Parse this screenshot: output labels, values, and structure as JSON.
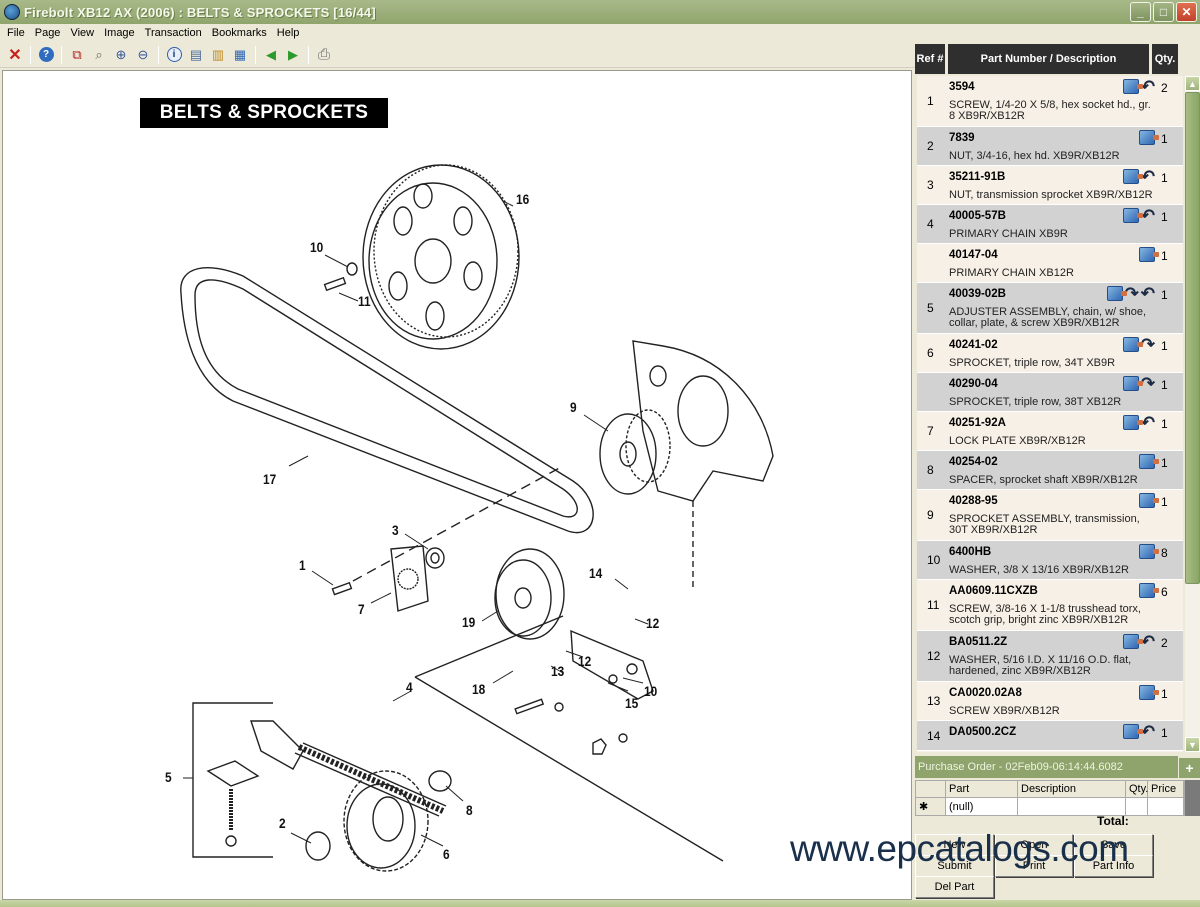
{
  "window": {
    "title": "Firebolt XB12 AX (2006) : BELTS & SPROCKETS [16/44]",
    "controls": [
      "minimize",
      "maximize",
      "close"
    ]
  },
  "menu": [
    "File",
    "Page",
    "View",
    "Image",
    "Transaction",
    "Bookmarks",
    "Help"
  ],
  "toolbar": [
    {
      "icon": "close-icon",
      "glyph": "✕"
    },
    {
      "icon": "help-icon",
      "glyph": "?"
    },
    {
      "icon": "fit-window-icon",
      "glyph": "⧉"
    },
    {
      "icon": "zoom-icon",
      "glyph": "⌕"
    },
    {
      "icon": "zoom-in-icon",
      "glyph": "⊕"
    },
    {
      "icon": "zoom-out-icon",
      "glyph": "⊖"
    },
    {
      "icon": "info-icon",
      "glyph": "i"
    },
    {
      "icon": "document-icon",
      "glyph": "▤"
    },
    {
      "icon": "bookmark-icon",
      "glyph": "▥"
    },
    {
      "icon": "add-to-order-icon",
      "glyph": "▦"
    },
    {
      "icon": "previous-page-icon",
      "glyph": "◀"
    },
    {
      "icon": "next-page-icon",
      "glyph": "▶"
    },
    {
      "icon": "print-icon",
      "glyph": "⎙"
    }
  ],
  "diagram": {
    "title": "BELTS & SPROCKETS",
    "callouts": [
      "1",
      "2",
      "3",
      "4",
      "5",
      "6",
      "7",
      "8",
      "9",
      "10",
      "10",
      "11",
      "12",
      "12",
      "13",
      "14",
      "15",
      "16",
      "17",
      "18",
      "19"
    ]
  },
  "parts_header": {
    "ref": "Ref #",
    "part": "Part Number / Description",
    "qty": "Qty."
  },
  "parts": [
    {
      "ref": "1",
      "part": "3594",
      "desc": "SCREW, 1/4-20 X 5/8, hex socket hd., gr. 8 XB9R/XB12R",
      "qty": "2",
      "icons": [
        "add-to-order",
        "back-arrow"
      ]
    },
    {
      "ref": "2",
      "part": "7839",
      "desc": "NUT, 3/4-16, hex hd. XB9R/XB12R",
      "qty": "1",
      "icons": [
        "add-to-order"
      ]
    },
    {
      "ref": "3",
      "part": "35211-91B",
      "desc": "NUT, transmission sprocket XB9R/XB12R",
      "qty": "1",
      "icons": [
        "add-to-order",
        "back-arrow"
      ]
    },
    {
      "ref": "4",
      "part": "40005-57B",
      "desc": "PRIMARY CHAIN XB9R",
      "qty": "1",
      "icons": [
        "add-to-order",
        "back-arrow"
      ]
    },
    {
      "ref": "",
      "part": "40147-04",
      "desc": "PRIMARY CHAIN XB12R",
      "qty": "1",
      "icons": [
        "add-to-order"
      ]
    },
    {
      "ref": "5",
      "part": "40039-02B",
      "desc": "ADJUSTER ASSEMBLY, chain, w/ shoe, collar, plate, & screw XB9R/XB12R",
      "qty": "1",
      "icons": [
        "add-to-order",
        "forward-arrow",
        "back-arrow"
      ]
    },
    {
      "ref": "6",
      "part": "40241-02",
      "desc": "SPROCKET, triple row, 34T XB9R",
      "qty": "1",
      "icons": [
        "add-to-order",
        "forward-arrow"
      ]
    },
    {
      "ref": "",
      "part": "40290-04",
      "desc": "SPROCKET, triple row, 38T XB12R",
      "qty": "1",
      "icons": [
        "add-to-order",
        "forward-arrow"
      ]
    },
    {
      "ref": "7",
      "part": "40251-92A",
      "desc": "LOCK PLATE XB9R/XB12R",
      "qty": "1",
      "icons": [
        "add-to-order",
        "back-arrow"
      ]
    },
    {
      "ref": "8",
      "part": "40254-02",
      "desc": "SPACER, sprocket shaft XB9R/XB12R",
      "qty": "1",
      "icons": [
        "add-to-order"
      ]
    },
    {
      "ref": "9",
      "part": "40288-95",
      "desc": "SPROCKET ASSEMBLY, transmission, 30T XB9R/XB12R",
      "qty": "1",
      "icons": [
        "add-to-order"
      ]
    },
    {
      "ref": "10",
      "part": "6400HB",
      "desc": "WASHER, 3/8 X 13/16 XB9R/XB12R",
      "qty": "8",
      "icons": [
        "add-to-order"
      ]
    },
    {
      "ref": "11",
      "part": "AA0609.11CXZB",
      "desc": "SCREW, 3/8-16 X 1-1/8 trusshead torx, scotch grip, bright zinc XB9R/XB12R",
      "qty": "6",
      "icons": [
        "add-to-order"
      ]
    },
    {
      "ref": "12",
      "part": "BA0511.2Z",
      "desc": "WASHER, 5/16 I.D. X 11/16 O.D. flat, hardened, zinc XB9R/XB12R",
      "qty": "2",
      "icons": [
        "add-to-order",
        "back-arrow"
      ]
    },
    {
      "ref": "13",
      "part": "CA0020.02A8",
      "desc": "SCREW XB9R/XB12R",
      "qty": "1",
      "icons": [
        "add-to-order"
      ]
    },
    {
      "ref": "14",
      "part": "DA0500.2CZ",
      "desc": "",
      "qty": "1",
      "icons": [
        "add-to-order",
        "back-arrow"
      ]
    }
  ],
  "purchase_order": {
    "title": "Purchase Order - 02Feb09-06:14:44.6082",
    "add_label": "+",
    "columns": [
      "",
      "Part",
      "Description",
      "Qty.",
      "Price"
    ],
    "rows": [
      {
        "marker": "✱",
        "part": "(null)",
        "desc": "",
        "qty": "",
        "price": ""
      }
    ],
    "total_label": "Total:",
    "buttons": {
      "new": "New",
      "open": "Open",
      "save": "Save",
      "submit": "Submit",
      "print": "Print",
      "part_info": "Part Info",
      "del_part": "Del Part"
    }
  },
  "watermark": "www.epcatalogs.com"
}
